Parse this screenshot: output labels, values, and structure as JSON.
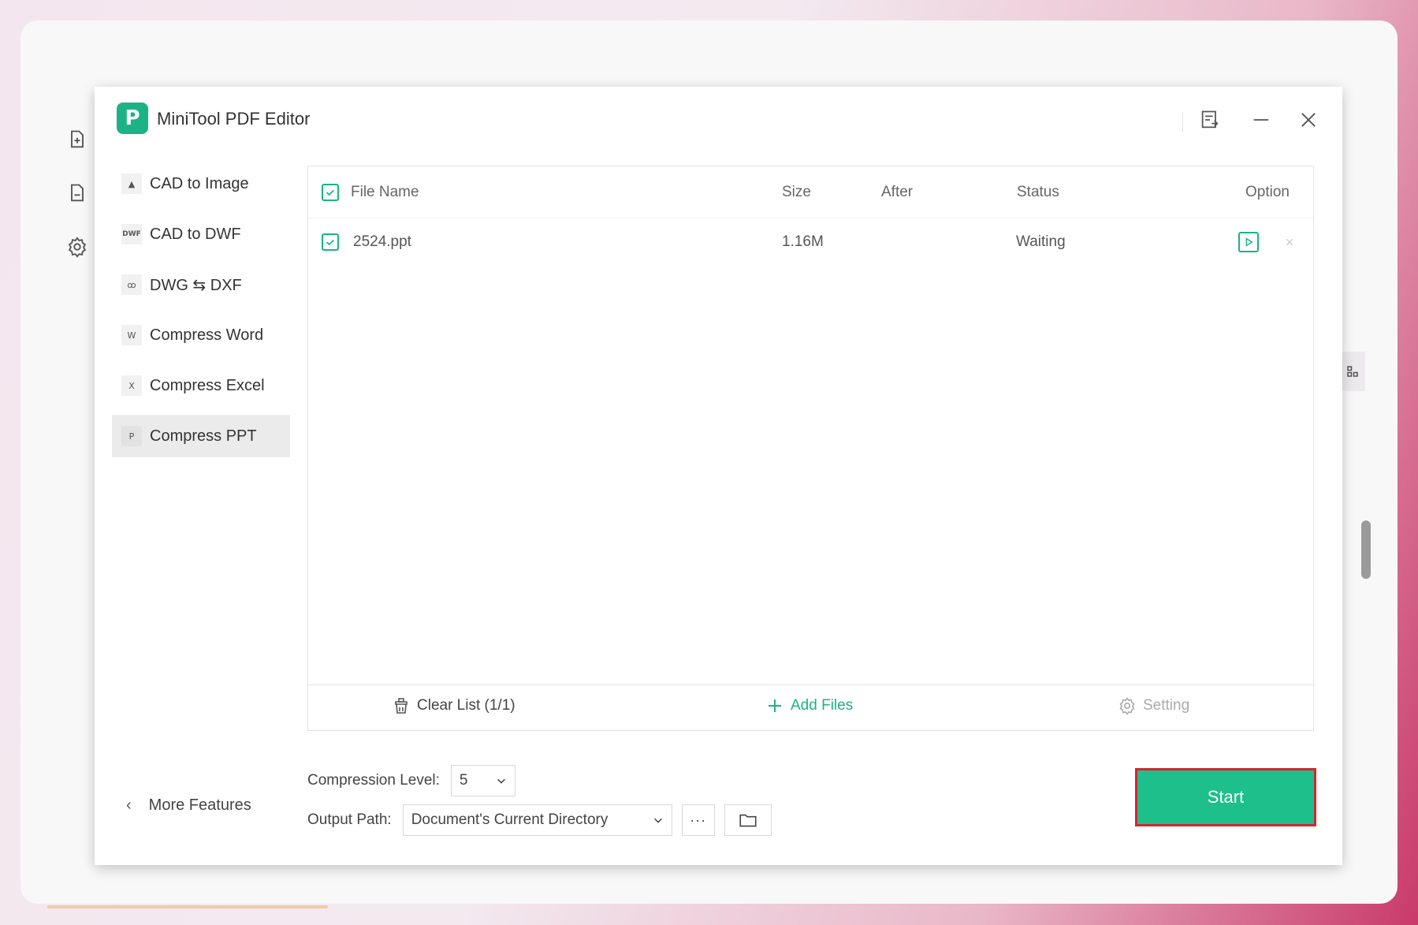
{
  "app": {
    "title": "MiniTool PDF Editor",
    "logo_letter": "P"
  },
  "colors": {
    "accent": "#1bb386",
    "start_button": "#1dbf8a",
    "start_highlight": "#d8232f"
  },
  "sidebar": {
    "items": [
      {
        "label": "CAD to Image",
        "icon": "image-icon",
        "icon_glyph": "▲"
      },
      {
        "label": "CAD to DWF",
        "icon": "dwf-icon",
        "icon_glyph": "DWF"
      },
      {
        "label": "DWG ⇆ DXF",
        "icon": "dwg-dxf-icon",
        "icon_glyph": "ꝏ"
      },
      {
        "label": "Compress Word",
        "icon": "word-compress-icon",
        "icon_glyph": "W"
      },
      {
        "label": "Compress Excel",
        "icon": "excel-compress-icon",
        "icon_glyph": "X"
      },
      {
        "label": "Compress PPT",
        "icon": "ppt-compress-icon",
        "icon_glyph": "P",
        "active": true
      }
    ],
    "more_features": "More Features"
  },
  "file_list": {
    "columns": {
      "name": "File Name",
      "size": "Size",
      "after": "After",
      "status": "Status",
      "option": "Option"
    },
    "rows": [
      {
        "name": "2524.ppt",
        "size": "1.16M",
        "after": "",
        "status": "Waiting",
        "checked": true
      }
    ]
  },
  "footer": {
    "clear_list": "Clear List (1/1)",
    "add_files": "Add Files",
    "setting": "Setting"
  },
  "controls": {
    "compression_label": "Compression Level:",
    "compression_value": "5",
    "output_label": "Output Path:",
    "output_value": "Document's Current Directory",
    "more_glyph": "···"
  },
  "start_label": "Start"
}
